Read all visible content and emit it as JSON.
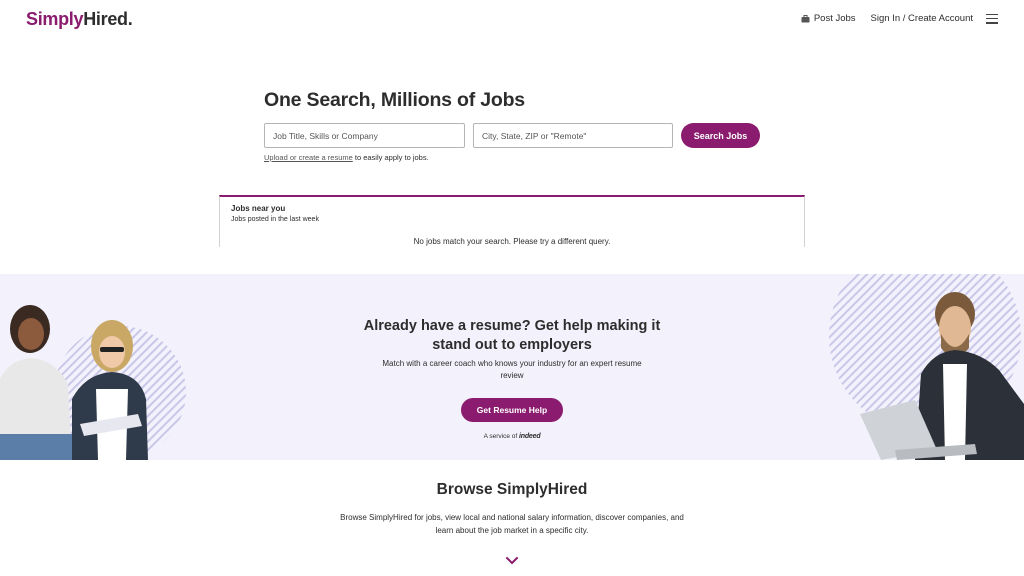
{
  "header": {
    "logo_simply": "Simply",
    "logo_hired": "Hired.",
    "post_jobs": "Post Jobs",
    "sign_in": "Sign In / Create Account",
    "icons": {
      "post_jobs": "briefcase-icon",
      "menu": "hamburger-menu-icon"
    }
  },
  "hero": {
    "title": "One Search, Millions of Jobs",
    "what_placeholder": "Job Title, Skills or Company",
    "where_placeholder": "City, State, ZIP or \"Remote\"",
    "search_button": "Search Jobs",
    "upload_link": "Upload or create a resume",
    "upload_suffix": " to easily apply to jobs."
  },
  "jobs_near_you": {
    "title": "Jobs near you",
    "subtitle": "Jobs posted in the last week",
    "empty_message": "No jobs match your search. Please try a different query."
  },
  "promo": {
    "title": "Already have a resume? Get help making it stand out to employers",
    "subtitle": "Match with a career coach who knows your industry for an expert resume review",
    "button": "Get Resume Help",
    "service_prefix": "A service of",
    "service_brand": "indeed"
  },
  "browse": {
    "title": "Browse SimplyHired",
    "text": "Browse SimplyHired for jobs, view local and national salary information, discover companies, and learn about the job market in a specific city.",
    "expand_icon": "chevron-down-icon"
  },
  "colors": {
    "brand": "#8a1b6e",
    "promo_bg": "#f3f2fc",
    "text": "#2d2d2d"
  }
}
